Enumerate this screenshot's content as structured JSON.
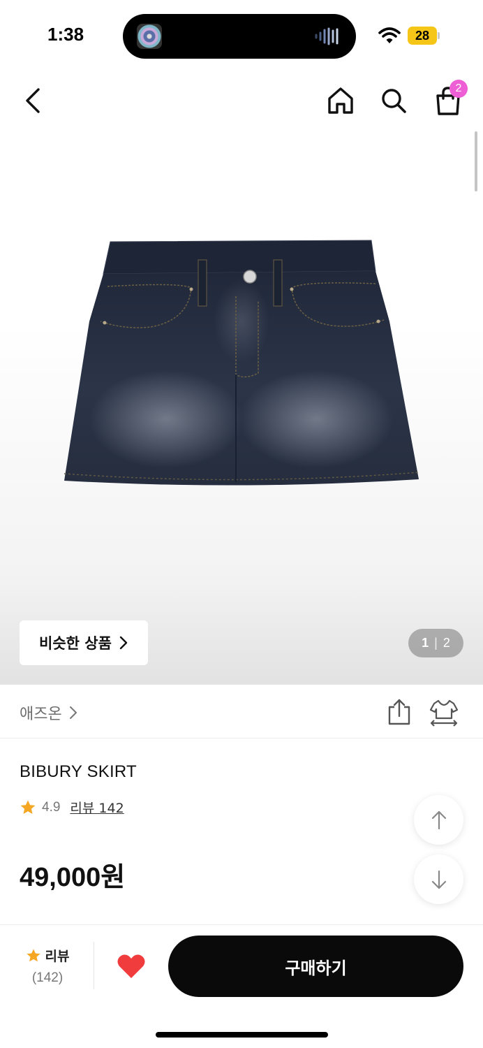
{
  "status_bar": {
    "time": "1:38",
    "battery": "28",
    "icons": [
      "album-art-icon",
      "audio-wave-icon",
      "wifi-icon",
      "battery-icon"
    ]
  },
  "header": {
    "icons": [
      "back-arrow-icon",
      "home-icon",
      "search-icon",
      "shopping-bag-icon"
    ],
    "cart_count": "2"
  },
  "gallery": {
    "similar_label": "비슷한 상품",
    "page_current": "1",
    "page_separator": "|",
    "page_total": "2"
  },
  "brand": {
    "name": "애즈온",
    "icons": [
      "chevron-right-icon",
      "share-icon",
      "fitting-icon"
    ]
  },
  "product": {
    "name": "BIBURY SKIRT",
    "rating": "4.9",
    "review_link": "리뷰 142",
    "price": "49,000원"
  },
  "bottom_bar": {
    "review_label": "리뷰",
    "review_count": "(142)",
    "buy_label": "구매하기"
  },
  "colors": {
    "accent_badge": "#ee5fd6",
    "star": "#f5a623",
    "heart": "#f03c3c",
    "buy_button": "#0a0a0a"
  }
}
